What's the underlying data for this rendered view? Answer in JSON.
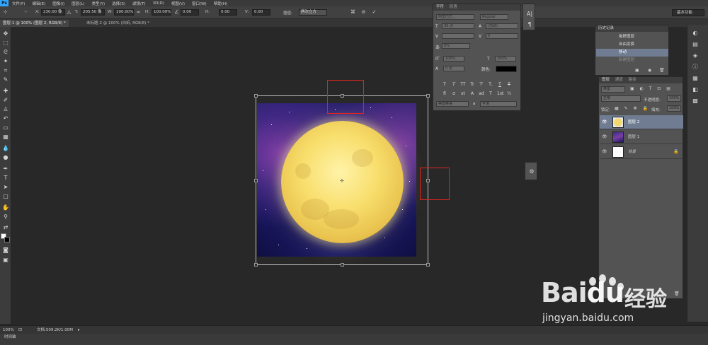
{
  "app": {
    "logo": "Ps"
  },
  "menu": [
    "文件(F)",
    "编辑(E)",
    "图像(I)",
    "图层(L)",
    "类型(Y)",
    "选择(S)",
    "滤镜(T)",
    "3D(D)",
    "视图(V)",
    "窗口(W)",
    "帮助(H)"
  ],
  "options": {
    "x_label": "X:",
    "x_value": "230.00 像",
    "y_label": "Y:",
    "y_value": "205.50 像",
    "w_label": "W:",
    "w_value": "100.00%",
    "h_label": "H:",
    "h_value": "100.00%",
    "angle_value": "0.00",
    "hskew_label": "H:",
    "hskew_value": "0.00",
    "vskew_label": "V:",
    "vskew_value": "0.00",
    "interp_label": "插值:",
    "interp_value": "两次立方",
    "workspace": "基本功能"
  },
  "tabs": [
    {
      "label": "图层-1 @ 100% (图层 2, RGB/8) *",
      "active": true
    },
    {
      "label": "未标题-2 @ 100% (白纸, RGB/8) *",
      "active": false
    }
  ],
  "character": {
    "tab_char": "字符",
    "tab_para": "段落",
    "font_family": "阿里巴巴...",
    "font_style": "Regular",
    "size": "30 点",
    "leading": "(自动)",
    "kerning": "",
    "tracking": "0",
    "scale_pct": "0%",
    "vscale": "100%",
    "hscale": "100%",
    "baseline": "0 点",
    "color_label": "颜色:",
    "styles": [
      "T",
      "T",
      "TT",
      "Tr",
      "T'",
      "T,",
      "T",
      "T"
    ],
    "opentype": [
      "fi",
      "σ",
      "st",
      "A",
      "ad",
      "T",
      "1st",
      "½"
    ],
    "language": "美国英语",
    "aa": "a",
    "aa_mode": "平滑"
  },
  "history": {
    "title": "历史记录",
    "items": [
      {
        "label": "拖移图层",
        "active": false
      },
      {
        "label": "自由变换",
        "active": false
      },
      {
        "label": "移动",
        "active": true
      },
      {
        "label": "新建图层",
        "active": false
      }
    ]
  },
  "layers": {
    "tabs": [
      "图层",
      "通道",
      "路径"
    ],
    "filter": "类型",
    "blend": "正常",
    "opacity_label": "不透明度:",
    "opacity": "100%",
    "lock_label": "锁定:",
    "fill_label": "填充:",
    "fill": "100%",
    "items": [
      {
        "name": "图层 2",
        "active": true
      },
      {
        "name": "图层 1",
        "active": false
      },
      {
        "name": "背景",
        "active": false
      }
    ]
  },
  "status": {
    "zoom": "100%",
    "doc": "文档:509.2K/1.00M"
  },
  "timeline": {
    "label": "时间轴"
  },
  "watermark": {
    "logo_a": "Bai",
    "logo_b": "du",
    "cn": "经验",
    "url": "jingyan.baidu.com"
  },
  "colors": {
    "accent": "#31a8ff",
    "highlight": "#e0231f",
    "selected_row": "#6f7c92"
  }
}
